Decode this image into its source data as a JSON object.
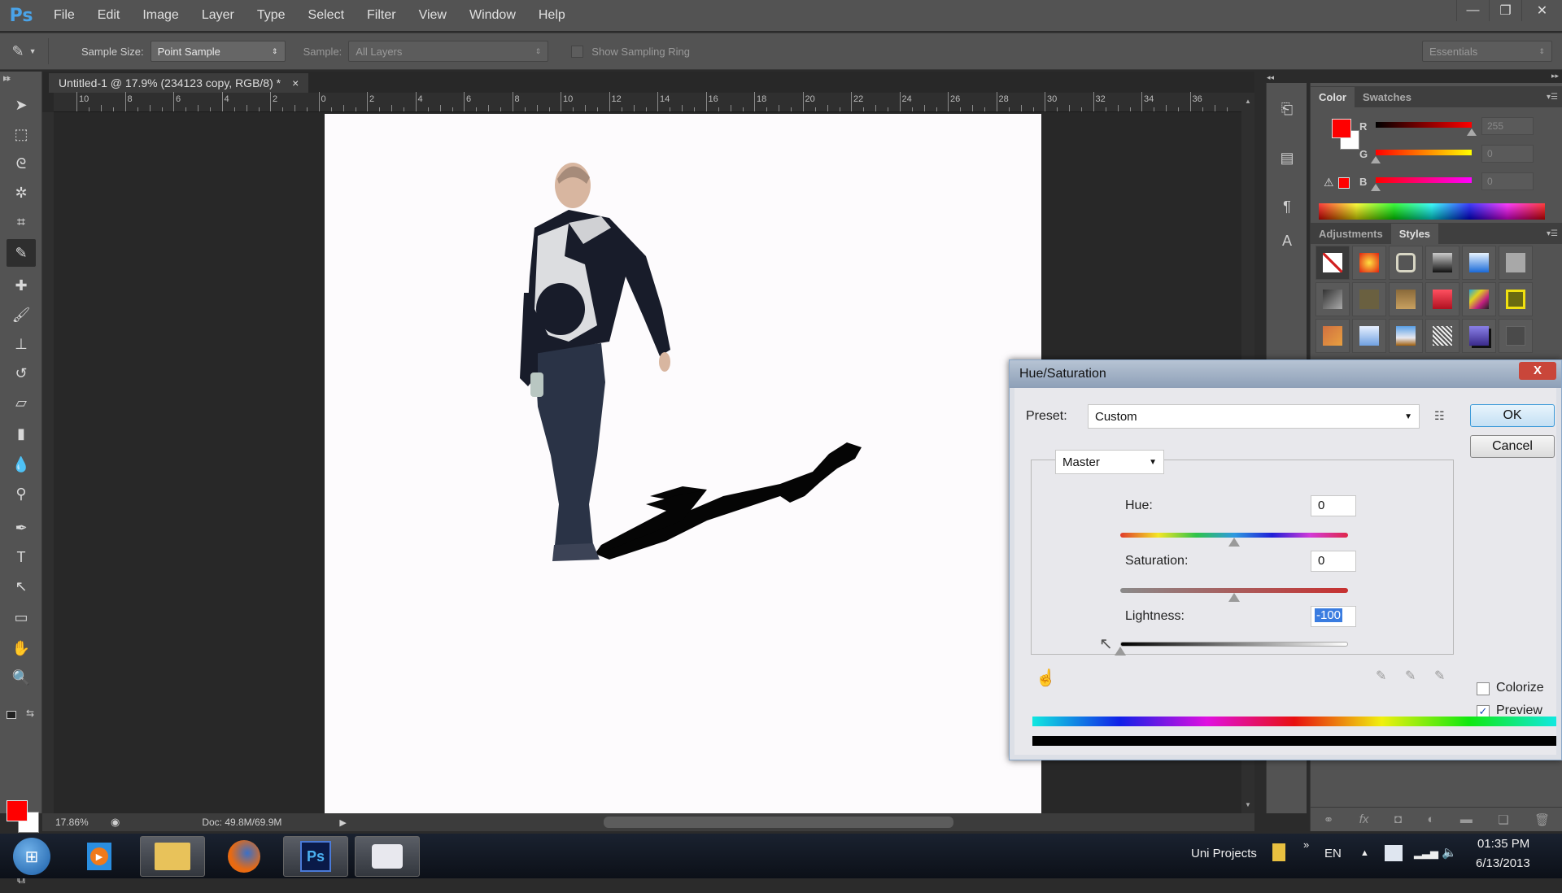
{
  "app": {
    "logo": "Ps",
    "menu": [
      "File",
      "Edit",
      "Image",
      "Layer",
      "Type",
      "Select",
      "Filter",
      "View",
      "Window",
      "Help"
    ],
    "window_controls": {
      "minimize": "—",
      "restore": "❐",
      "close": "✕"
    }
  },
  "options_bar": {
    "tool_icon": "eyedropper-icon",
    "sample_size_label": "Sample Size:",
    "sample_size_value": "Point Sample",
    "sample_label": "Sample:",
    "sample_value": "All Layers",
    "show_sampling_ring_label": "Show Sampling Ring",
    "show_sampling_ring_checked": false,
    "workspace": "Essentials"
  },
  "document": {
    "tab_title": "Untitled-1 @ 17.9% (234123 copy, RGB/8) *",
    "tab_close": "×",
    "ruler_labels": [
      "10",
      "8",
      "6",
      "4",
      "2",
      "0",
      "2",
      "4",
      "6",
      "8",
      "10",
      "12",
      "14",
      "16",
      "18",
      "20",
      "22",
      "24",
      "26",
      "28",
      "30",
      "32",
      "34",
      "36"
    ],
    "zoom": "17.86%",
    "doc_size": "Doc: 49.8M/69.9M"
  },
  "tools": [
    {
      "name": "move-tool",
      "glyph": "➤"
    },
    {
      "name": "marquee-tool",
      "glyph": "⬚"
    },
    {
      "name": "lasso-tool",
      "glyph": "ᘓ"
    },
    {
      "name": "magic-wand-tool",
      "glyph": "✲"
    },
    {
      "name": "crop-tool",
      "glyph": "⌗"
    },
    {
      "name": "eyedropper-tool",
      "glyph": "✎",
      "active": true
    },
    {
      "name": "healing-brush-tool",
      "glyph": "✚"
    },
    {
      "name": "brush-tool",
      "glyph": "🖌"
    },
    {
      "name": "clone-stamp-tool",
      "glyph": "⊥"
    },
    {
      "name": "history-brush-tool",
      "glyph": "↺"
    },
    {
      "name": "eraser-tool",
      "glyph": "▱"
    },
    {
      "name": "gradient-tool",
      "glyph": "▮"
    },
    {
      "name": "blur-tool",
      "glyph": "💧"
    },
    {
      "name": "dodge-tool",
      "glyph": "⚲"
    },
    {
      "name": "pen-tool",
      "glyph": "✒"
    },
    {
      "name": "type-tool",
      "glyph": "T"
    },
    {
      "name": "path-selection-tool",
      "glyph": "↖"
    },
    {
      "name": "rectangle-tool",
      "glyph": "▭"
    },
    {
      "name": "hand-tool",
      "glyph": "✋"
    },
    {
      "name": "zoom-tool",
      "glyph": "🔍"
    }
  ],
  "colors": {
    "foreground": "#ff0000",
    "background": "#ffffff",
    "accent_blue": "#3c9ad8"
  },
  "color_panel": {
    "tabs": [
      "Color",
      "Swatches"
    ],
    "active_tab": "Color",
    "channels": [
      {
        "label": "R",
        "value": "255",
        "position": 1.0
      },
      {
        "label": "G",
        "value": "0",
        "position": 0.0
      },
      {
        "label": "B",
        "value": "0",
        "position": 0.0
      }
    ]
  },
  "styles_panel": {
    "tabs": [
      "Adjustments",
      "Styles"
    ],
    "active_tab": "Styles",
    "styles": [
      "none",
      "orange-glow",
      "beveled-frame",
      "dark-chrome",
      "blue-glass",
      "gray-plain",
      "dark-gradient",
      "olive",
      "bronze",
      "red-bevel",
      "multicolor",
      "yellow-frame",
      "orange-sunset",
      "sky-blue",
      "landscape",
      "noise",
      "purple-shadow",
      "dark-square"
    ]
  },
  "layers_footer_icons": [
    "link-icon",
    "fx-icon",
    "mask-icon",
    "adjustment-icon",
    "folder-icon",
    "new-layer-icon",
    "trash-icon"
  ],
  "dialog": {
    "title": "Hue/Saturation",
    "close": "X",
    "preset_label": "Preset:",
    "preset_value": "Custom",
    "channel_value": "Master",
    "hue_label": "Hue:",
    "hue_value": "0",
    "saturation_label": "Saturation:",
    "saturation_value": "0",
    "lightness_label": "Lightness:",
    "lightness_value": "-100",
    "hue_slider": 0.5,
    "saturation_slider": 0.5,
    "lightness_slider": 0.0,
    "ok_label": "OK",
    "cancel_label": "Cancel",
    "colorize_label": "Colorize",
    "colorize_checked": false,
    "preview_label": "Preview",
    "preview_checked": true
  },
  "taskbar": {
    "apps": [
      "start",
      "media-player",
      "file-explorer",
      "firefox",
      "photoshop",
      "camera-recorder"
    ],
    "toolbar_label": "Uni Projects",
    "language": "EN",
    "time": "01:35 PM",
    "date": "6/13/2013"
  }
}
